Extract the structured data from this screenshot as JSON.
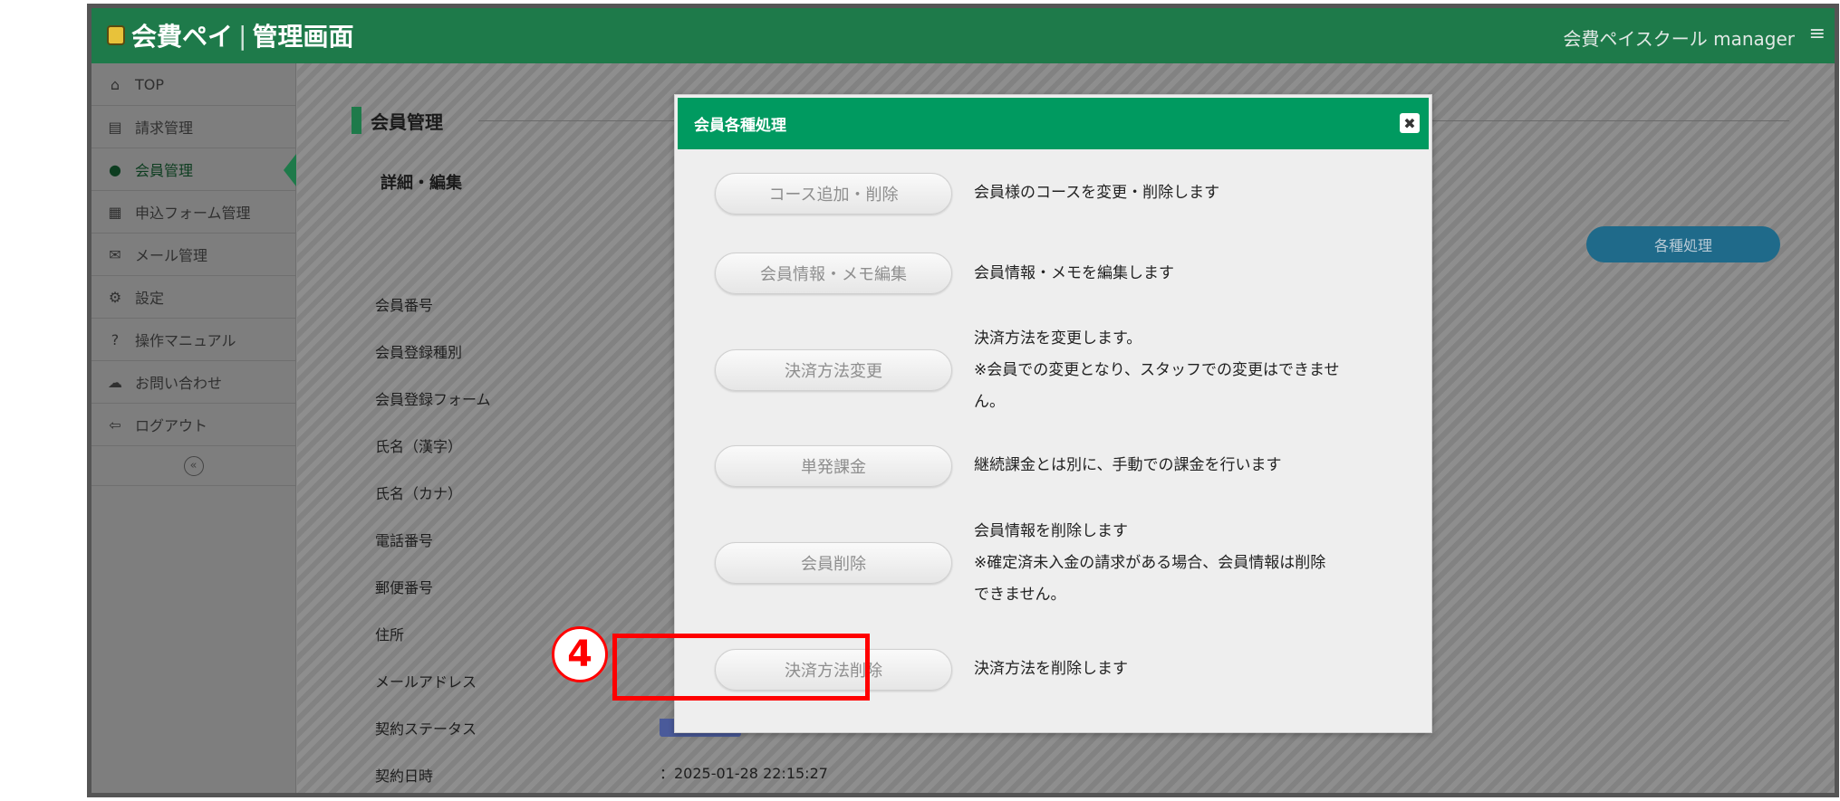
{
  "header": {
    "logo_brand": "会費ペイ",
    "logo_separator": "|",
    "logo_section": "管理画面",
    "user_label": "会費ペイスクール manager",
    "menu_icon": "≡"
  },
  "sidebar": {
    "items": [
      {
        "label": "TOP",
        "icon": "⌂"
      },
      {
        "label": "請求管理",
        "icon": "▤"
      },
      {
        "label": "会員管理",
        "icon": "●"
      },
      {
        "label": "申込フォーム管理",
        "icon": "▦"
      },
      {
        "label": "メール管理",
        "icon": "✉"
      },
      {
        "label": "設定",
        "icon": "⚙"
      },
      {
        "label": "操作マニュアル",
        "icon": "?"
      },
      {
        "label": "お問い合わせ",
        "icon": "☁"
      },
      {
        "label": "ログアウト",
        "icon": "⇦"
      }
    ],
    "collapse_label": "«",
    "active_index": 2
  },
  "main": {
    "section_title": "会員管理",
    "sub_title": "詳細・編集",
    "action_button": "各種処理",
    "fields": [
      "会員番号",
      "会員登録種別",
      "会員登録フォーム",
      "氏名（漢字）",
      "氏名（カナ）",
      "電話番号",
      "郵便番号",
      "住所",
      "メールアドレス",
      "契約ステータス",
      "契約日時"
    ],
    "contract_date_value": "：2025-01-28 22:15:27"
  },
  "modal": {
    "title": "会員各種処理",
    "close_icon": "✖",
    "actions": [
      {
        "button": "コース追加・削除",
        "lines": [
          "会員様のコースを変更・削除します"
        ]
      },
      {
        "button": "会員情報・メモ編集",
        "lines": [
          "会員情報・メモを編集します"
        ]
      },
      {
        "button": "決済方法変更",
        "lines": [
          "決済方法を変更します。",
          "※会員での変更となり、スタッフでの変更はできませ",
          "ん。"
        ]
      },
      {
        "button": "単発課金",
        "lines": [
          "継続課金とは別に、手動での課金を行います"
        ]
      },
      {
        "button": "会員削除",
        "lines": [
          "会員情報を削除します",
          "※確定済未入金の請求がある場合、会員情報は削除",
          "できません。"
        ]
      },
      {
        "button": "決済方法削除",
        "lines": [
          "決済方法を削除します"
        ]
      }
    ]
  },
  "annotation": {
    "step_marker": "4",
    "highlight_color": "#ff0000"
  },
  "colors": {
    "header_green": "#1e7a4a",
    "modal_header_green": "#009a60",
    "action_button_blue": "#1f6a8a"
  }
}
